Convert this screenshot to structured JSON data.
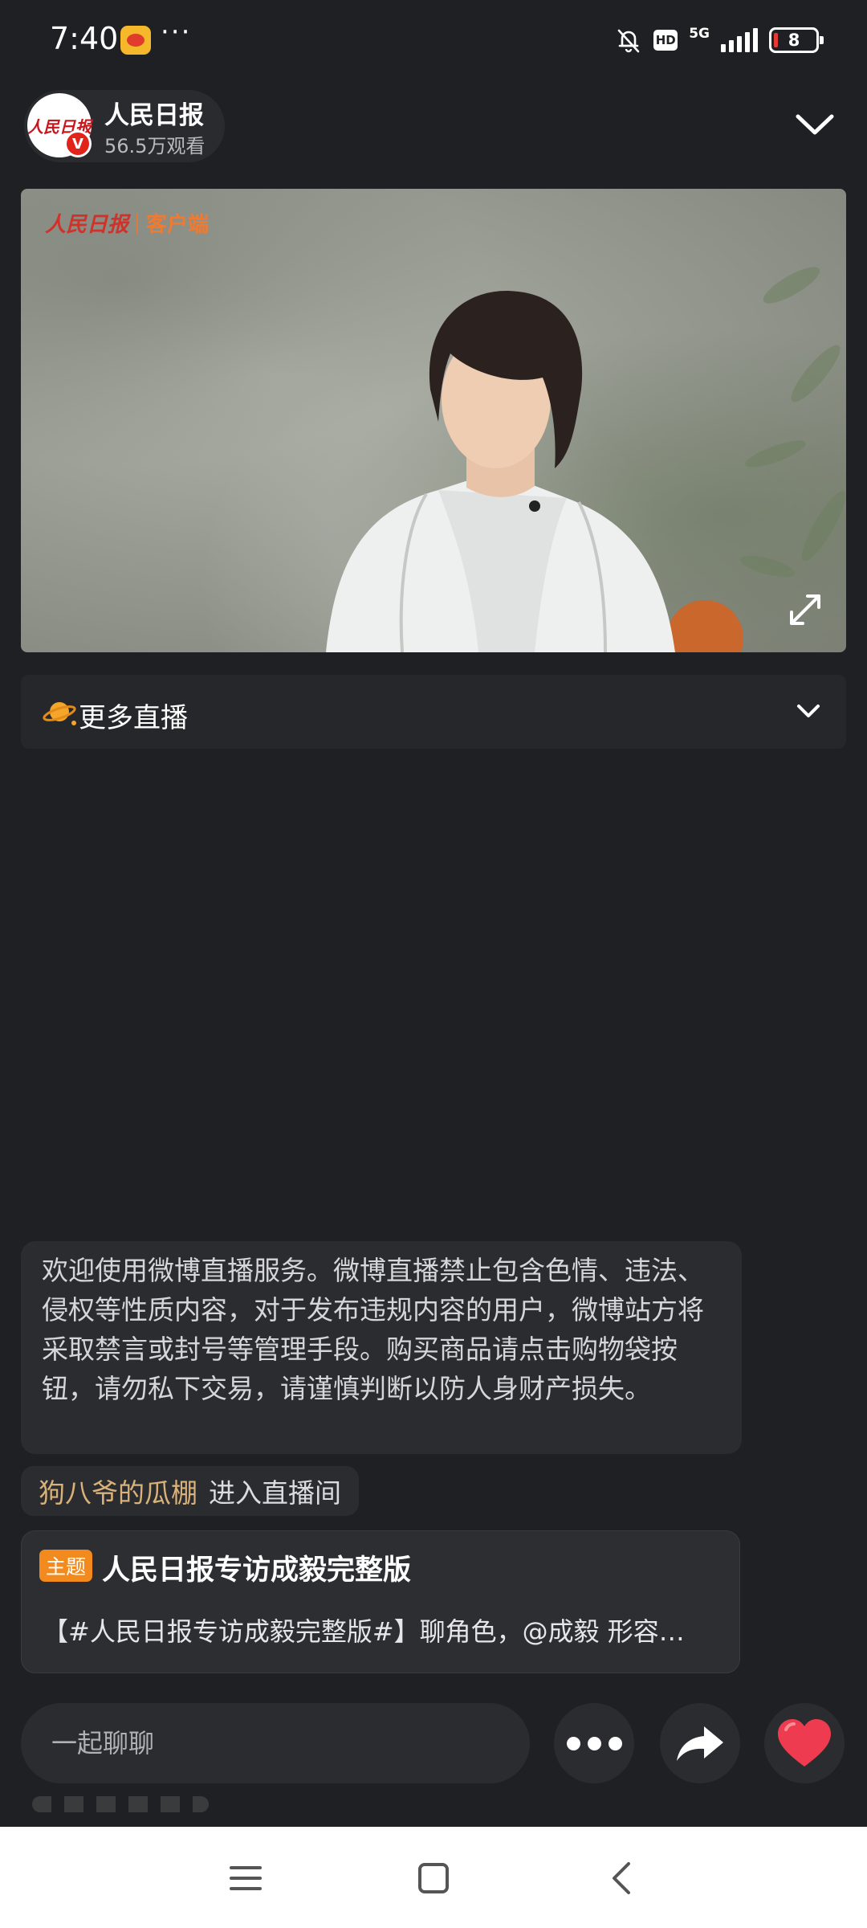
{
  "status_bar": {
    "time": "7:40",
    "more": "···",
    "hd": "HD",
    "network": "5G",
    "battery": "8"
  },
  "header": {
    "channel_name": "人民日报",
    "viewer_count": "56.5万观看",
    "avatar_text": "人民日报",
    "verified_badge": "V"
  },
  "video": {
    "watermark_logo": "人民日报",
    "watermark_text": "客户端"
  },
  "more_live": {
    "label": "更多直播"
  },
  "chat": {
    "notice": "欢迎使用微博直播服务。微博直播禁止包含色情、违法、侵权等性质内容，对于发布违规内容的用户，微博站方将采取禁言或封号等管理手段。购买商品请点击购物袋按钮，请勿私下交易，请谨慎判断以防人身财产损失。",
    "enter_user": "狗八爷的瓜棚",
    "enter_text": "进入直播间"
  },
  "topic": {
    "badge": "主题",
    "title": "人民日报专访成毅完整版",
    "description": "【#人民日报专访成毅完整版#】聊角色，@成毅 形容…"
  },
  "input_bar": {
    "placeholder": "一起聊聊"
  },
  "colors": {
    "background": "#1f2023",
    "card": "#2b2c30",
    "accent_orange": "#f28a1e",
    "username_gold": "#d9b27a",
    "like_red": "#ee3b4f"
  }
}
